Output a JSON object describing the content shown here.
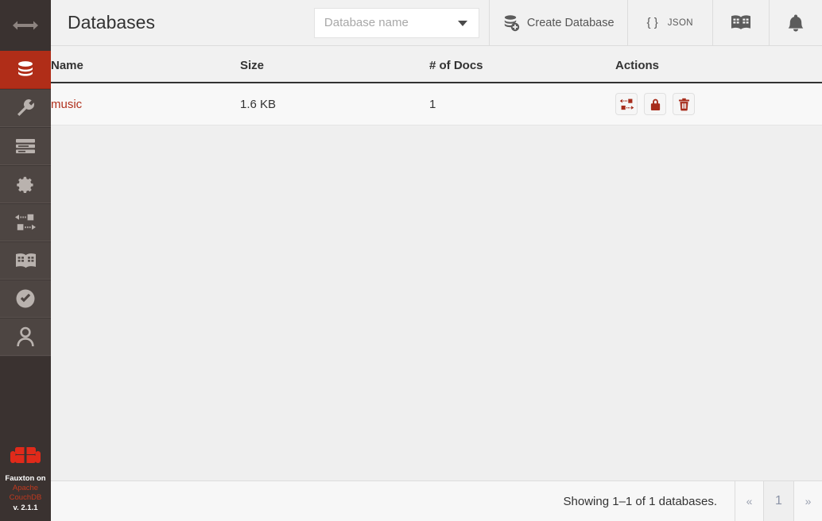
{
  "sidebar": {
    "toggle": {
      "name": "sidebar-toggle",
      "icon": "arrows-horizontal-icon"
    },
    "items": [
      {
        "id": "databases",
        "icon": "database-stack-icon",
        "active": true
      },
      {
        "id": "setup",
        "icon": "wrench-icon",
        "active": false
      },
      {
        "id": "active-tasks",
        "icon": "server-list-icon",
        "active": false
      },
      {
        "id": "configuration",
        "icon": "gear-icon",
        "active": false
      },
      {
        "id": "replication",
        "icon": "replication-icon",
        "active": false
      },
      {
        "id": "documentation",
        "icon": "book-icon",
        "active": false
      },
      {
        "id": "verify",
        "icon": "check-circle-icon",
        "active": false
      },
      {
        "id": "account",
        "icon": "user-icon",
        "active": false
      }
    ],
    "footer": {
      "logo": "couch-logo",
      "line1": "Fauxton on",
      "line2": "Apache",
      "line3": "CouchDB",
      "version": "v. 2.1.1"
    }
  },
  "header": {
    "title": "Databases",
    "search": {
      "placeholder": "Database name",
      "value": "",
      "caret_icon": "chevron-down-icon"
    },
    "buttons": [
      {
        "id": "create-database",
        "label": "Create Database",
        "icon": "database-plus-icon"
      },
      {
        "id": "json",
        "label": "JSON",
        "brace": "{ }",
        "icon": "json-icon"
      },
      {
        "id": "documentation",
        "label": "",
        "icon": "book-icon"
      },
      {
        "id": "notifications",
        "label": "",
        "icon": "bell-icon"
      }
    ]
  },
  "table": {
    "columns": [
      "Name",
      "Size",
      "# of Docs",
      "Actions"
    ],
    "rows": [
      {
        "name": "music",
        "size": "1.6 KB",
        "docs": "1",
        "actions": [
          {
            "id": "replicate",
            "icon": "replication-icon"
          },
          {
            "id": "permissions",
            "icon": "lock-icon"
          },
          {
            "id": "delete",
            "icon": "trash-icon"
          }
        ]
      }
    ]
  },
  "footer": {
    "showing": "Showing 1–1 of 1 databases.",
    "pagination": {
      "first": "«",
      "current": "1",
      "last": "»"
    }
  },
  "colors": {
    "brand_red": "#b0301c",
    "sidebar_bg": "#4d4542",
    "sidebar_dark": "#3a3230",
    "body_bg": "#efefef",
    "header_bg": "#f1f1f1"
  }
}
